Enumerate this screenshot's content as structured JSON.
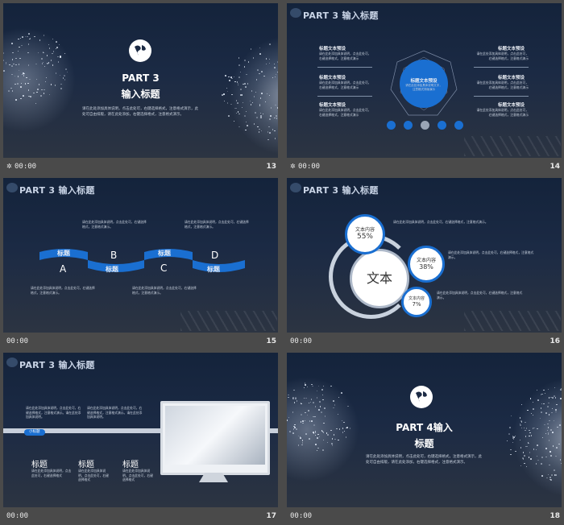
{
  "slides": [
    {
      "num": "13",
      "time": "00:00",
      "part": "PART 3",
      "title": "输入标题",
      "body": "请在此处添加具体说明，点击此处可，右键选择格式，注意格式演示，此处可自由排版，请在此处添加，右键选择格式，注意格式演示。"
    },
    {
      "num": "14",
      "time": "00:00",
      "header": "PART 3 输入标题",
      "center_title": "标题文本预设",
      "center_text": "请在此处添加具体说明文字，注意格式排版演示",
      "left": [
        {
          "title": "标题文本预设",
          "text": "请在此处添加具体说明，点击此处可，右键选择格式，注意格式演示"
        },
        {
          "title": "标题文本预设",
          "text": "请在此处添加具体说明，点击此处可，右键选择格式，注意格式演示"
        },
        {
          "title": "标题文本预设",
          "text": "请在此处添加具体说明，点击此处可，右键选择格式，注意格式演示"
        }
      ],
      "right": [
        {
          "title": "标题文本预设",
          "text": "请在此处添加具体说明，点击此处可，右键选择格式，注意格式演示"
        },
        {
          "title": "标题文本预设",
          "text": "请在此处添加具体说明，点击此处可，右键选择格式，注意格式演示"
        },
        {
          "title": "标题文本预设",
          "text": "请在此处添加具体说明，点击此处可，右键选择格式，注意格式演示"
        }
      ]
    },
    {
      "num": "15",
      "time": "00:00",
      "header": "PART 3 输入标题",
      "letters": [
        "A",
        "B",
        "C",
        "D"
      ],
      "tabs": [
        "标题",
        "标题",
        "标题",
        "标题"
      ],
      "text": "请在此处添加具体说明，点击此处可，右键选择格式，注意格式演示。"
    },
    {
      "num": "16",
      "time": "00:00",
      "header": "PART 3 输入标题",
      "center": "文本",
      "items": [
        {
          "label": "文本内容",
          "value": "55%"
        },
        {
          "label": "文本内容",
          "value": "38%"
        },
        {
          "label": "文本内容",
          "value": "7%"
        }
      ],
      "text": "请在此处添加具体说明，点击此处可，右键选择格式，注意格式演示。"
    },
    {
      "num": "17",
      "time": "00:00",
      "header": "PART 3 输入标题",
      "tag": "小标题",
      "cols": [
        {
          "title": "标题",
          "text": "请在此处添加具体说明，点击此处可，右键选择格式"
        },
        {
          "title": "标题",
          "text": "请在此处添加具体说明，点击此处可，右键选择格式"
        },
        {
          "title": "标题",
          "text": "请在此处添加具体说明，点击此处可，右键选择格式"
        }
      ],
      "text": "请在此处添加具体说明，点击此处可，右键选择格式，注意格式演示。请在此处添加具体说明。"
    },
    {
      "num": "18",
      "time": "00:00",
      "part": "PART 4输入",
      "title": "标题",
      "body": "请在此处添加具体说明，点击此处可，右键选择格式，注意格式演示，此处可自由排版，请在此处添加，右键选择格式，注意格式演示。"
    }
  ],
  "colors": {
    "accent": "#1a6fd1",
    "bg_top": "#14233b",
    "bg_bottom": "#2c3442",
    "page_bg": "#4a4a4a"
  },
  "icons": [
    "globe-icon",
    "play-icon",
    "circle-icon",
    "transition-icon"
  ]
}
